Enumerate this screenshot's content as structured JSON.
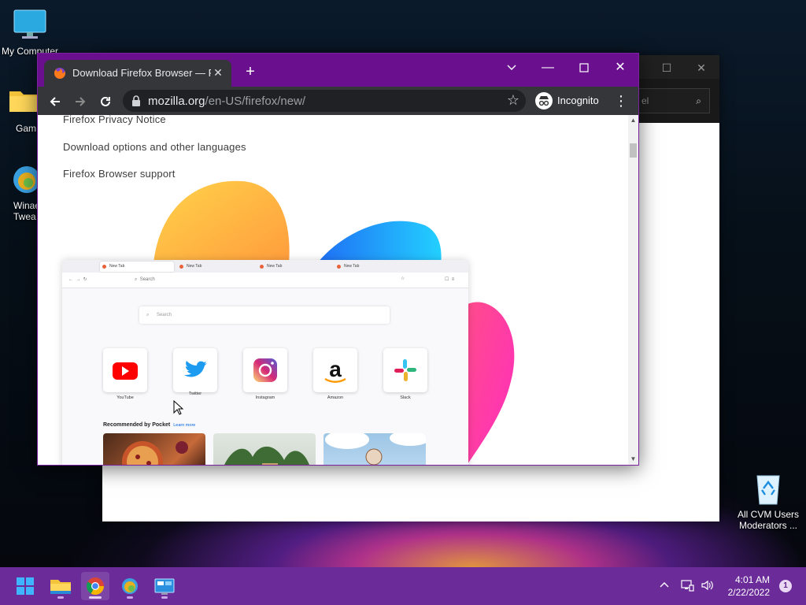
{
  "desktop": {
    "icons": [
      {
        "label": "My Computer"
      },
      {
        "label": "Gam"
      },
      {
        "label": "Winaero Twea"
      },
      {
        "label": "All CVM Users Moderators ..."
      }
    ]
  },
  "background_window": {
    "search_placeholder": "el"
  },
  "chrome": {
    "tab_title": "Download Firefox Browser — Fast, Private & Free",
    "url_host": "mozilla.org",
    "url_path": "/en-US/firefox/new/",
    "profile_label": "Incognito"
  },
  "page": {
    "links": [
      "Firefox Privacy Notice",
      "Download options and other languages",
      "Firefox Browser support"
    ],
    "mock_browser": {
      "tabs": [
        "New Tab",
        "New Tab",
        "New Tab",
        "New Tab"
      ],
      "address_placeholder": "Search",
      "search_placeholder": "Search",
      "shortcuts": [
        "YouTube",
        "Twitter",
        "Instagram",
        "Amazon",
        "Slack"
      ],
      "pocket_heading": "Recommended by Pocket",
      "pocket_learn": "Learn more"
    }
  },
  "taskbar": {
    "time": "4:01 AM",
    "date": "2/22/2022",
    "notification_count": "1"
  },
  "colors": {
    "chrome_frame": "#6a0f8e",
    "taskbar": "#6b2c9a",
    "toolbar": "#35363a"
  }
}
